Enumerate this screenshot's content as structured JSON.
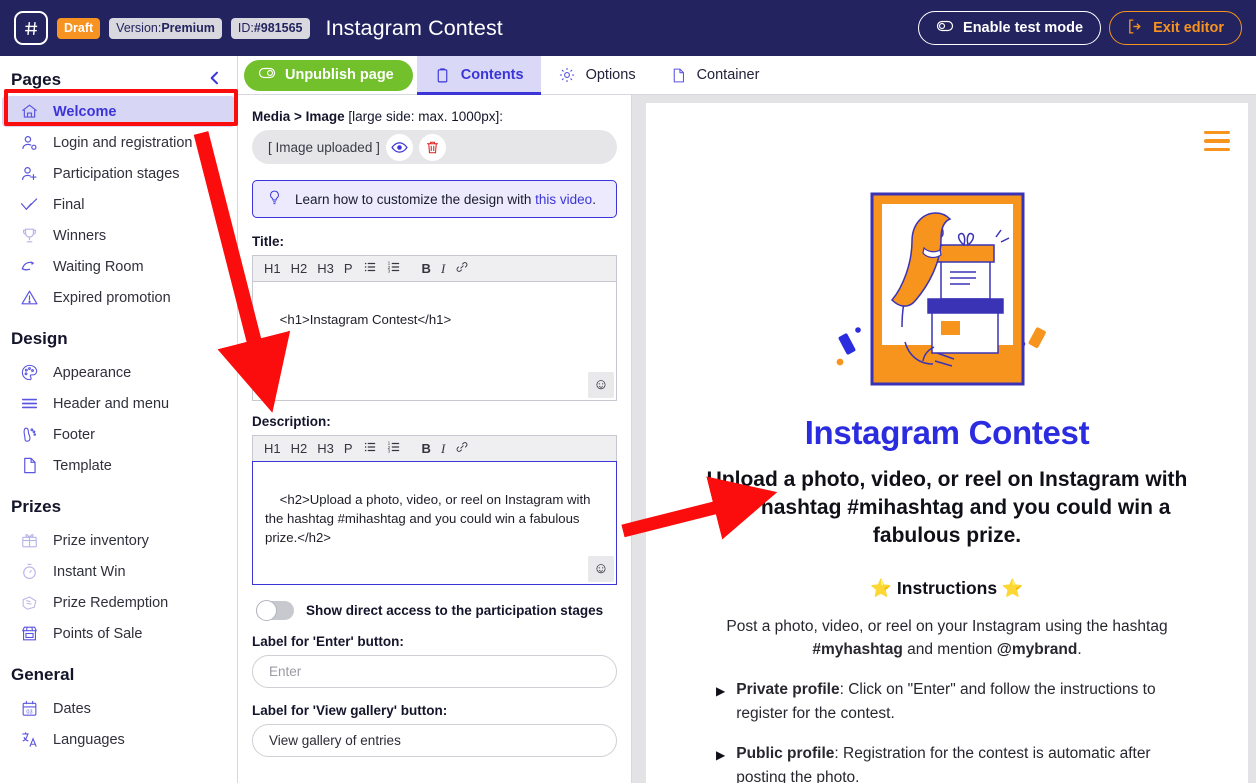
{
  "topbar": {
    "logo_icon": "hash-logo-icon",
    "draft_badge": "Draft",
    "version_prefix": "Version: ",
    "version_value": "Premium",
    "id_prefix": "ID: ",
    "id_value": "#981565",
    "title": "Instagram Contest",
    "test_mode_label": "Enable test mode",
    "exit_label": "Exit editor",
    "bg_color": "#232360",
    "draft_color": "#f79320",
    "exit_color": "#f7941d"
  },
  "sidebar": {
    "title": "Pages",
    "collapse_icon": "chevron-left-icon",
    "groups": [
      {
        "label": "Pages",
        "items": [
          {
            "label": "Welcome",
            "icon": "home-icon",
            "active": true
          },
          {
            "label": "Login and registration",
            "icon": "user-login-icon",
            "active": false
          },
          {
            "label": "Participation stages",
            "icon": "user-stages-icon",
            "active": false
          },
          {
            "label": "Final",
            "icon": "check-icon",
            "active": false
          },
          {
            "label": "Winners",
            "icon": "trophy-icon",
            "active": false
          },
          {
            "label": "Waiting Room",
            "icon": "waiting-room-icon",
            "active": false
          },
          {
            "label": "Expired promotion",
            "icon": "warning-triangle-icon",
            "active": false
          }
        ]
      },
      {
        "label": "Design",
        "items": [
          {
            "label": "Appearance",
            "icon": "palette-icon",
            "active": false
          },
          {
            "label": "Header and menu",
            "icon": "menu-lines-icon",
            "active": false
          },
          {
            "label": "Footer",
            "icon": "footprint-icon",
            "active": false
          },
          {
            "label": "Template",
            "icon": "page-icon",
            "active": false
          }
        ]
      },
      {
        "label": "Prizes",
        "items": [
          {
            "label": "Prize inventory",
            "icon": "gift-icon",
            "active": false,
            "dim": true
          },
          {
            "label": "Instant Win",
            "icon": "stopwatch-icon",
            "active": false,
            "dim": true
          },
          {
            "label": "Prize Redemption",
            "icon": "ticket-icon",
            "active": false,
            "dim": true
          },
          {
            "label": "Points of Sale",
            "icon": "store-icon",
            "active": false
          }
        ]
      },
      {
        "label": "General",
        "items": [
          {
            "label": "Dates",
            "icon": "calendar-icon",
            "active": false
          },
          {
            "label": "Languages",
            "icon": "translate-icon",
            "active": false
          }
        ]
      }
    ]
  },
  "toolbar": {
    "unpublish_label": "Unpublish page",
    "unpublish_color": "#72c02c",
    "tabs": [
      {
        "label": "Contents",
        "icon": "clipboard-icon",
        "active": true
      },
      {
        "label": "Options",
        "icon": "gear-icon",
        "active": false
      },
      {
        "label": "Container",
        "icon": "page-icon",
        "active": false
      }
    ]
  },
  "form": {
    "media_label_bold": "Media > Image",
    "media_label_light": " [large side: max. 1000px]:",
    "upload_value": "[ Image uploaded ]",
    "preview_icon": "eye-icon",
    "delete_icon": "trash-icon",
    "tip_icon": "lightbulb-icon",
    "tip_text": "Learn how to customize the design with ",
    "tip_link": "this video",
    "tip_tail": ".",
    "rte_buttons": [
      "H1",
      "H2",
      "H3",
      "P",
      "ul-list-icon",
      "ol-list-icon",
      "B",
      "I",
      "link-icon"
    ],
    "title_label": "Title:",
    "title_value": "<h1>Instagram Contest</h1>",
    "description_label": "Description:",
    "description_value": "<h2>Upload a photo, video, or reel on Instagram with the hashtag #mihashtag and you could win a fabulous prize.</h2>\n\n\n<h3>⭐ Instructions ⭐</h3>\n<p>Post a photo, video, or reel on your Instagram usin",
    "emoji_icon": "emoji-icon",
    "toggle_label": "Show direct access to the participation stages",
    "toggle_on": false,
    "enter_label": "Label for 'Enter' button:",
    "enter_placeholder": "Enter",
    "gallery_label": "Label for 'View gallery' button:",
    "gallery_value": "View gallery of entries"
  },
  "preview": {
    "menu_icon": "hamburger-menu-icon",
    "hero_icon": "gift-frame-illustration",
    "heading": "Instagram Contest",
    "subheading": "Upload a photo, video, or reel on Instagram with the hashtag #mihashtag and you could win a fabulous prize.",
    "instructions_heading": "⭐ Instructions ⭐",
    "paragraph_1": "Post a photo, video, or reel on your Instagram using the",
    "paragraph_2_pre": "hashtag ",
    "paragraph_2_bold1": "#myhashtag",
    "paragraph_2_mid": " and mention ",
    "paragraph_2_bold2": "@mybrand",
    "paragraph_2_tail": ".",
    "bullets": [
      {
        "bold": "Private profile",
        "text": ": Click on \"Enter\" and follow the instructions to register for the contest."
      },
      {
        "bold": "Public profile",
        "text": ": Registration for the contest is automatic after posting the photo."
      }
    ],
    "accent_blue": "#2b2be0",
    "accent_orange": "#f7941d"
  },
  "annotations": {
    "highlight_color": "#fb0d0d",
    "arrow_1": "arrow-pointing-to-title-field",
    "arrow_2": "arrow-pointing-to-preview-subheading"
  }
}
